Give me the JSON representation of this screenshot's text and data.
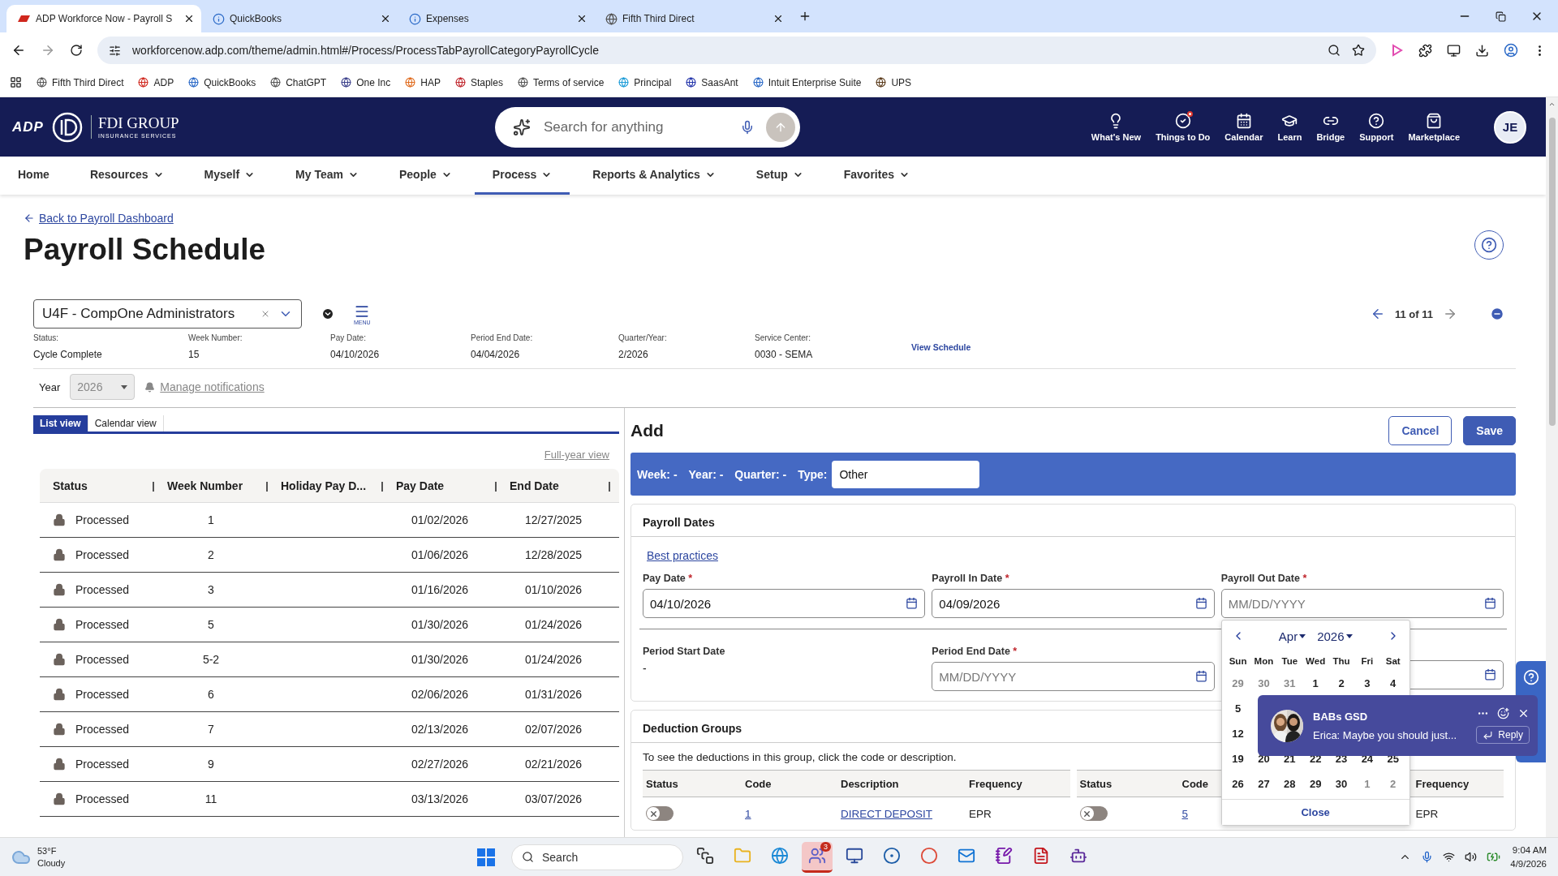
{
  "browser": {
    "tabs": [
      {
        "title": "ADP Workforce Now - Payroll S",
        "selected": true
      },
      {
        "title": "QuickBooks",
        "selected": false
      },
      {
        "title": "Expenses",
        "selected": false
      },
      {
        "title": "Fifth Third Direct",
        "selected": false
      }
    ],
    "url": "workforcenow.adp.com/theme/admin.html#/Process/ProcessTabPayrollCategoryPayrollCycle",
    "bookmarks": [
      "Fifth Third Direct",
      "ADP",
      "QuickBooks",
      "ChatGPT",
      "One Inc",
      "HAP",
      "Staples",
      "Terms of service",
      "Principal",
      "SaasAnt",
      "Intuit Enterprise Suite",
      "UPS"
    ]
  },
  "header": {
    "logo": "ADP",
    "brand": "FDI GROUP",
    "brand_sub": "INSURANCE SERVICES",
    "search_placeholder": "Search for anything",
    "tools": [
      {
        "label": "What's New",
        "alert": false
      },
      {
        "label": "Things to Do",
        "alert": true
      },
      {
        "label": "Calendar",
        "alert": false
      },
      {
        "label": "Learn",
        "alert": false
      },
      {
        "label": "Bridge",
        "alert": false
      },
      {
        "label": "Support",
        "alert": false
      },
      {
        "label": "Marketplace",
        "alert": false
      }
    ],
    "avatar": "JE"
  },
  "nav": [
    {
      "label": "Home",
      "selected": false,
      "dropdown": false
    },
    {
      "label": "Resources",
      "selected": false,
      "dropdown": true
    },
    {
      "label": "Myself",
      "selected": false,
      "dropdown": true
    },
    {
      "label": "My Team",
      "selected": false,
      "dropdown": true
    },
    {
      "label": "People",
      "selected": false,
      "dropdown": true
    },
    {
      "label": "Process",
      "selected": true,
      "dropdown": true
    },
    {
      "label": "Reports & Analytics",
      "selected": false,
      "dropdown": true
    },
    {
      "label": "Setup",
      "selected": false,
      "dropdown": true
    },
    {
      "label": "Favorites",
      "selected": false,
      "dropdown": true
    }
  ],
  "page": {
    "back_link": "Back to Payroll Dashboard",
    "title": "Payroll Schedule",
    "company": "U4F - CompOne Administrators",
    "menu_label": "MENU",
    "pager": "11 of 11",
    "info": [
      {
        "label": "Status:",
        "value": "Cycle Complete"
      },
      {
        "label": "Week Number:",
        "value": "15"
      },
      {
        "label": "Pay Date:",
        "value": "04/10/2026"
      },
      {
        "label": "Period End Date:",
        "value": "04/04/2026"
      },
      {
        "label": "Quarter/Year:",
        "value": "2/2026"
      },
      {
        "label": "Service Center:",
        "value": "0030 - SEMA"
      }
    ],
    "view_schedule": "View Schedule",
    "year": {
      "label": "Year",
      "value": "2026",
      "disabled": true
    },
    "manage_notifications": "Manage notifications",
    "view_tabs": [
      {
        "label": "List view",
        "selected": true
      },
      {
        "label": "Calendar view",
        "selected": false
      }
    ],
    "full_year_view": "Full-year view",
    "schedule_table": {
      "columns": [
        "Status",
        "Week Number",
        "Holiday Pay D...",
        "Pay Date",
        "End Date"
      ],
      "rows": [
        {
          "locked": true,
          "status": "Processed",
          "week": "1",
          "pay_date": "01/02/2026",
          "end_date": "12/27/2025"
        },
        {
          "locked": true,
          "status": "Processed",
          "week": "2",
          "pay_date": "01/06/2026",
          "end_date": "12/28/2025"
        },
        {
          "locked": true,
          "status": "Processed",
          "week": "3",
          "pay_date": "01/16/2026",
          "end_date": "01/10/2026"
        },
        {
          "locked": true,
          "status": "Processed",
          "week": "5",
          "pay_date": "01/30/2026",
          "end_date": "01/24/2026"
        },
        {
          "locked": true,
          "status": "Processed",
          "week": "5-2",
          "pay_date": "01/30/2026",
          "end_date": "01/24/2026"
        },
        {
          "locked": true,
          "status": "Processed",
          "week": "6",
          "pay_date": "02/06/2026",
          "end_date": "01/31/2026"
        },
        {
          "locked": true,
          "status": "Processed",
          "week": "7",
          "pay_date": "02/13/2026",
          "end_date": "02/07/2026"
        },
        {
          "locked": true,
          "status": "Processed",
          "week": "9",
          "pay_date": "02/27/2026",
          "end_date": "02/21/2026"
        },
        {
          "locked": true,
          "status": "Processed",
          "week": "11",
          "pay_date": "03/13/2026",
          "end_date": "03/07/2026"
        }
      ]
    },
    "add_form": {
      "title": "Add",
      "buttons": [
        {
          "label": "Cancel",
          "kind": "secondary"
        },
        {
          "label": "Save",
          "kind": "primary"
        }
      ],
      "summary": [
        {
          "label": "Week:",
          "value": "-"
        },
        {
          "label": "Year:",
          "value": "-"
        },
        {
          "label": "Quarter:",
          "value": "-"
        }
      ],
      "type": {
        "label": "Type:",
        "value": "Other"
      },
      "payroll_dates": {
        "title": "Payroll Dates",
        "link": "Best practices",
        "fields": [
          {
            "label": "Pay Date",
            "required": "*",
            "value": "04/10/2026"
          },
          {
            "label": "Payroll In Date",
            "required": "*",
            "value": "04/09/2026"
          },
          {
            "label": "Payroll Out Date",
            "required": "*",
            "placeholder": "MM/DD/YYYY"
          }
        ],
        "period": [
          {
            "kind": "text",
            "label": "Period Start Date",
            "value": "-"
          },
          {
            "kind": "date",
            "label": "Period End Date",
            "required": "*",
            "placeholder": "MM/DD/YYYY"
          },
          {
            "kind": "date"
          }
        ]
      },
      "deductions": {
        "title": "Deduction Groups",
        "hint": "To see the deductions in this group, click the code or description.",
        "groups": [
          {
            "columns": [
              {
                "kind": "status",
                "label": "Status"
              },
              {
                "kind": "code",
                "label": "Code"
              },
              {
                "kind": "description",
                "label": "Description"
              },
              {
                "kind": "frequency",
                "label": "Frequency"
              }
            ],
            "rows": [
              {
                "on": false,
                "code": "1",
                "description": "DIRECT DEPOSIT",
                "frequency": "EPR"
              }
            ]
          },
          {
            "columns": [
              {
                "kind": "status",
                "label": "Status"
              },
              {
                "kind": "code",
                "label": "Code"
              },
              {
                "kind": "frequency",
                "label": "Frequency"
              }
            ],
            "rows": [
              {
                "on": false,
                "code": "5",
                "frequency": "EPR"
              }
            ]
          }
        ]
      }
    },
    "calendar": {
      "month": "Apr",
      "year": "2026",
      "weekdays": [
        "Sun",
        "Mon",
        "Tue",
        "Wed",
        "Thu",
        "Fri",
        "Sat"
      ],
      "weeks": [
        [
          {
            "label": "29",
            "muted": true
          },
          {
            "label": "30",
            "muted": true
          },
          {
            "label": "31",
            "muted": true
          },
          {
            "label": "1",
            "muted": false
          },
          {
            "label": "2",
            "muted": false
          },
          {
            "label": "3",
            "muted": false
          },
          {
            "label": "4",
            "muted": false
          }
        ],
        [
          {
            "label": "5",
            "muted": false
          }
        ],
        [
          {
            "label": "12",
            "muted": false
          }
        ],
        [
          {
            "label": "19",
            "muted": false
          },
          {
            "label": "20",
            "muted": false
          },
          {
            "label": "21",
            "muted": false
          },
          {
            "label": "22",
            "muted": false
          },
          {
            "label": "23",
            "muted": false
          },
          {
            "label": "24",
            "muted": false
          },
          {
            "label": "25",
            "muted": false
          }
        ],
        [
          {
            "label": "26",
            "muted": false
          },
          {
            "label": "27",
            "muted": false
          },
          {
            "label": "28",
            "muted": false
          },
          {
            "label": "29",
            "muted": false
          },
          {
            "label": "30",
            "muted": false
          },
          {
            "label": "1",
            "muted": true
          },
          {
            "label": "2",
            "muted": true
          }
        ]
      ],
      "close": "Close"
    }
  },
  "toast": {
    "title": "BABs GSD",
    "message": "Erica: Maybe you should just...",
    "action": "Reply"
  },
  "taskbar": {
    "weather": {
      "temp": "53°F",
      "desc": "Cloudy"
    },
    "search": "Search",
    "pinned": [
      {
        "selected": false
      },
      {
        "selected": false
      },
      {
        "selected": false
      },
      {
        "selected": true,
        "badge": "3"
      },
      {
        "selected": false
      },
      {
        "selected": false
      },
      {
        "selected": false
      },
      {
        "selected": false
      },
      {
        "selected": false
      },
      {
        "selected": false
      },
      {
        "selected": false
      }
    ],
    "time": "9:04 AM",
    "date": "4/9/2026"
  }
}
